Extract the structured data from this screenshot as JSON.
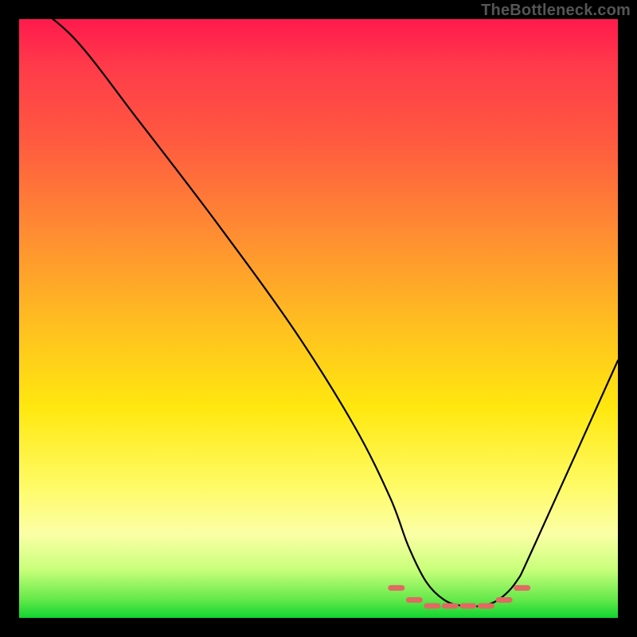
{
  "watermark": "TheBottleneck.com",
  "chart_data": {
    "type": "line",
    "title": "",
    "xlabel": "",
    "ylabel": "",
    "xlim": [
      0,
      100
    ],
    "ylim": [
      0,
      100
    ],
    "series": [
      {
        "name": "bottleneck-curve",
        "x": [
          0,
          9,
          20,
          33,
          46,
          56,
          62,
          65,
          68,
          71,
          74,
          77,
          80,
          83,
          86,
          100
        ],
        "values": [
          104,
          97,
          83,
          66,
          48,
          32,
          20,
          12,
          6,
          3,
          2,
          2,
          3,
          6,
          12,
          43
        ]
      }
    ],
    "valley_markers": {
      "name": "optimal-range",
      "x": [
        63,
        66,
        69,
        72,
        75,
        78,
        81,
        84
      ],
      "values": [
        5,
        3,
        2,
        2,
        2,
        2,
        3,
        5
      ]
    },
    "gradient_stops": [
      {
        "pos": 0,
        "color": "#ff1a4d"
      },
      {
        "pos": 8,
        "color": "#ff3b4a"
      },
      {
        "pos": 20,
        "color": "#ff5940"
      },
      {
        "pos": 35,
        "color": "#ff8a33"
      },
      {
        "pos": 52,
        "color": "#ffc21f"
      },
      {
        "pos": 65,
        "color": "#ffe80f"
      },
      {
        "pos": 78,
        "color": "#fffb66"
      },
      {
        "pos": 86,
        "color": "#fbffa6"
      },
      {
        "pos": 92,
        "color": "#c8ff7a"
      },
      {
        "pos": 97,
        "color": "#63e84a"
      },
      {
        "pos": 100,
        "color": "#11d430"
      }
    ]
  }
}
